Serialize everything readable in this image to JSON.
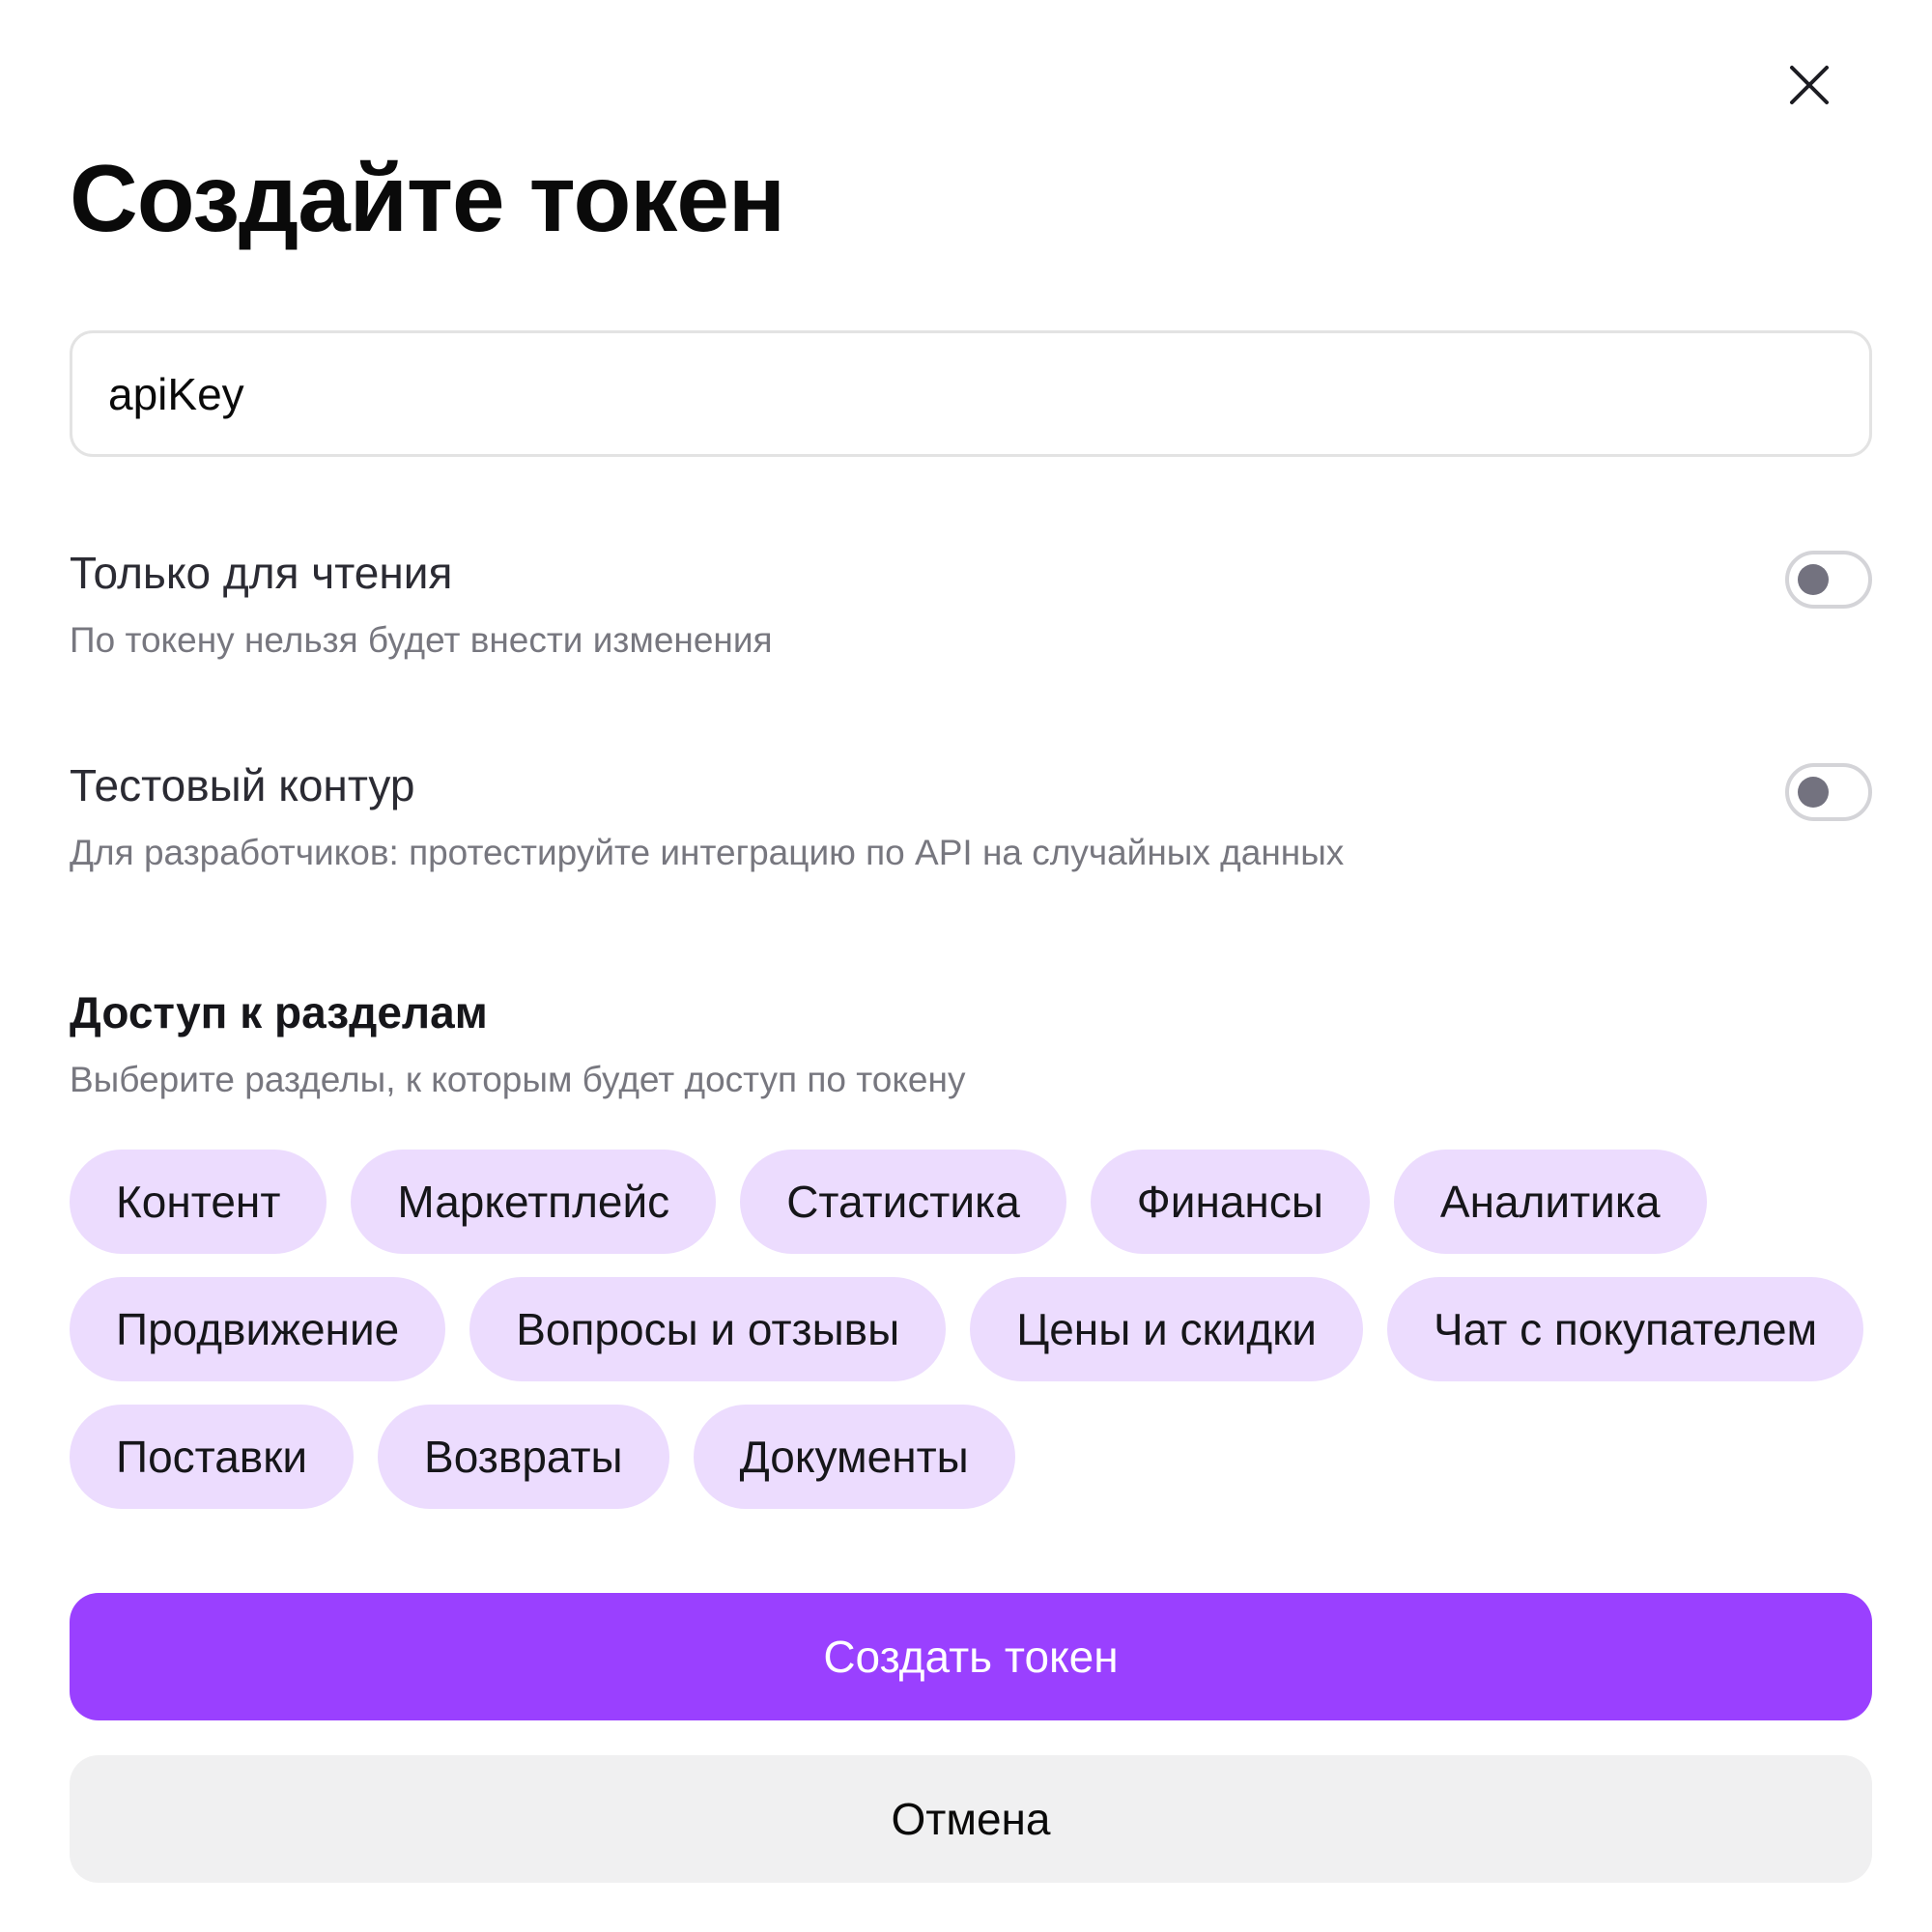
{
  "dialog": {
    "title": "Создайте токен",
    "close_icon": "close-icon"
  },
  "token_name": {
    "value": "apiKey"
  },
  "settings": {
    "read_only": {
      "title": "Только для чтения",
      "description": "По токену нельзя будет внести изменения",
      "enabled": false
    },
    "test_environment": {
      "title": "Тестовый контур",
      "description": "Для разработчиков: протестируйте интеграцию по API на случайных данных",
      "enabled": false
    }
  },
  "access": {
    "title": "Доступ к разделам",
    "description": "Выберите разделы, к которым будет доступ по токену",
    "sections": [
      "Контент",
      "Маркетплейс",
      "Статистика",
      "Финансы",
      "Аналитика",
      "Продвижение",
      "Вопросы и отзывы",
      "Цены и скидки",
      "Чат с покупателем",
      "Поставки",
      "Возвраты",
      "Документы"
    ]
  },
  "actions": {
    "create_label": "Создать токен",
    "cancel_label": "Отмена"
  },
  "colors": {
    "accent": "#9a40ff",
    "chip_background": "#ecdcfe",
    "toggle_knob": "#73727f",
    "secondary_button": "#f0f0f1"
  }
}
